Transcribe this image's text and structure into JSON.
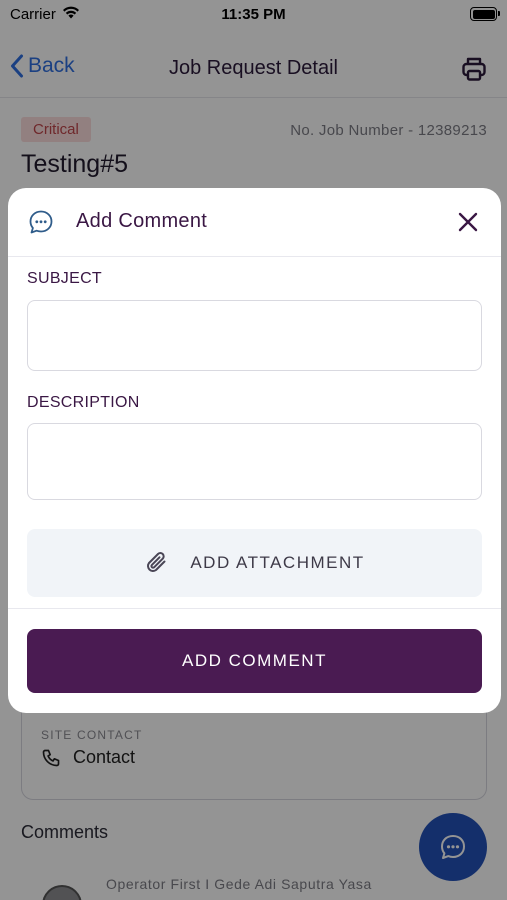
{
  "status_bar": {
    "carrier": "Carrier",
    "time": "11:35 PM"
  },
  "nav": {
    "back_label": "Back",
    "title": "Job Request Detail",
    "print_icon": "printer-icon"
  },
  "job": {
    "priority": "Critical",
    "job_number": "No. Job Number - 12389213",
    "title": "Testing#5"
  },
  "site": {
    "contact_label": "SITE CONTACT",
    "contact_value": "Contact"
  },
  "comments": {
    "heading": "Comments",
    "first_author": "Operator First I Gede Adi Saputra Yasa"
  },
  "modal": {
    "title": "Add Comment",
    "subject_label": "SUBJECT",
    "subject_value": "",
    "description_label": "DESCRIPTION",
    "description_value": "",
    "attach_label": "ADD ATTACHMENT",
    "submit_label": "ADD COMMENT"
  },
  "colors": {
    "brand_primary": "#4a1b52",
    "link_blue": "#2f6fe0",
    "fab_blue": "#2352b8",
    "critical_bg": "#fbdcdc",
    "critical_text": "#c0464b"
  }
}
